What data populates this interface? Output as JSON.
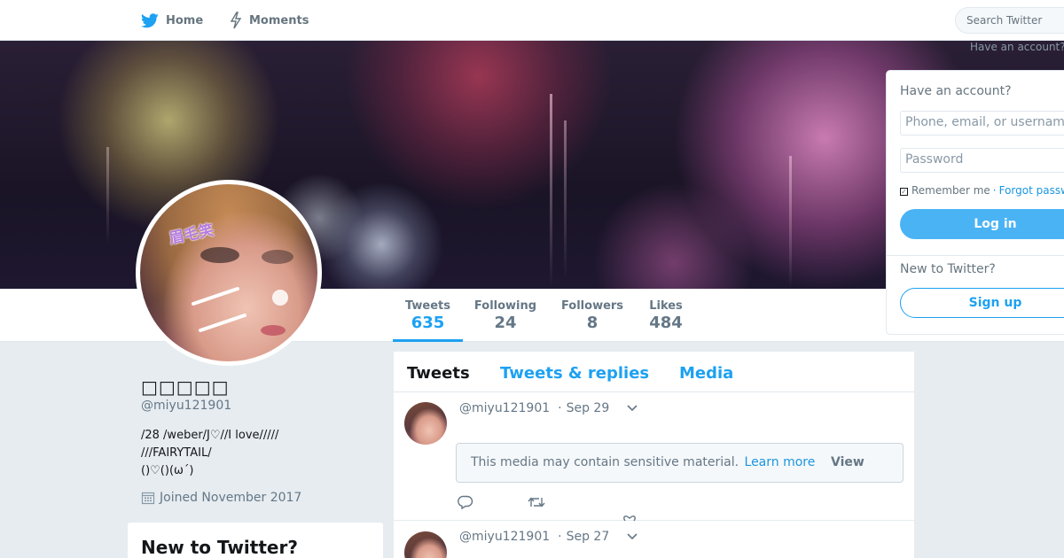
{
  "nav": {
    "home_label": "Home",
    "moments_label": "Moments",
    "search_placeholder": "Search Twitter",
    "have_account_faint": "Have an account?"
  },
  "profile": {
    "name": "□□□□□",
    "handle": "@miyu121901",
    "bio_lines": [
      "/28 /weber/J♡//I love/////",
      "///FAIRYTAIL/",
      "()♡()(ω´)"
    ],
    "joined": "Joined November 2017",
    "avatar_sticker": "眉毛笑"
  },
  "stats": [
    {
      "label": "Tweets",
      "value": "635",
      "active": true
    },
    {
      "label": "Following",
      "value": "24",
      "active": false
    },
    {
      "label": "Followers",
      "value": "8",
      "active": false
    },
    {
      "label": "Likes",
      "value": "484",
      "active": false
    }
  ],
  "login": {
    "title": "Have an account?",
    "username_placeholder": "Phone, email, or username",
    "password_placeholder": "Password",
    "remember_label": "Remember me",
    "separator": "·",
    "forgot_label": "Forgot password?",
    "login_button": "Log in",
    "new_title": "New to Twitter?",
    "signup_button": "Sign up"
  },
  "sidebar_newbox": {
    "title": "New to Twitter?"
  },
  "timeline": {
    "tabs": [
      {
        "label": "Tweets",
        "active": true
      },
      {
        "label": "Tweets & replies",
        "active": false
      },
      {
        "label": "Media",
        "active": false
      }
    ],
    "tweets": [
      {
        "handle": "@miyu121901",
        "date": "Sep 29",
        "sensitive_text": "This media may contain sensitive material.",
        "learn_more": "Learn more",
        "view": "View"
      },
      {
        "handle": "@miyu121901",
        "date": "Sep 27"
      }
    ]
  },
  "colors": {
    "accent": "#1da1f2",
    "login_button": "#4ab3f4",
    "background": "#e6ecf0"
  }
}
